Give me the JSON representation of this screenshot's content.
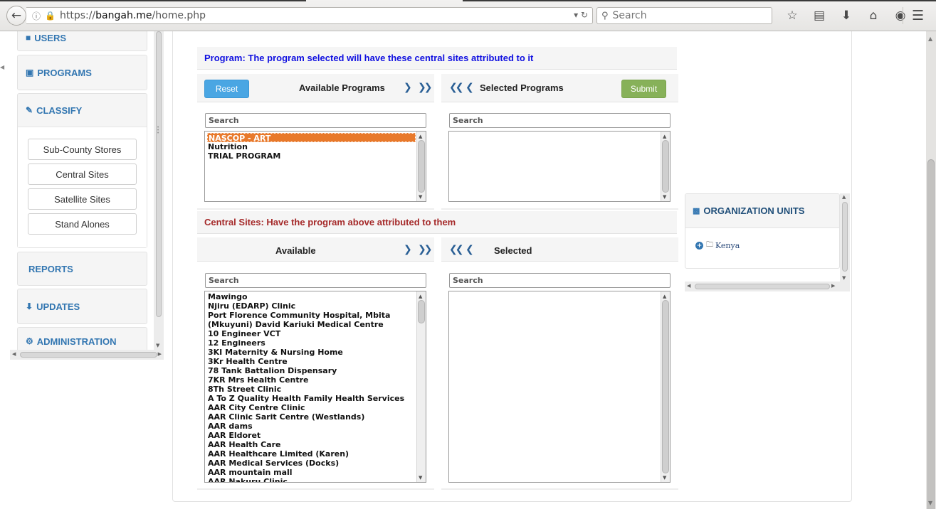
{
  "browser": {
    "url_scheme": "https://",
    "url_domain": "bangah.me",
    "url_path": "/home.php",
    "search_placeholder": "Search"
  },
  "sidebar": {
    "items": [
      {
        "label": "USERS",
        "icon": "users-icon"
      },
      {
        "label": "PROGRAMS",
        "icon": "briefcase-icon"
      },
      {
        "label": "CLASSIFY",
        "icon": "edit-icon"
      },
      {
        "label": "REPORTS"
      },
      {
        "label": "UPDATES",
        "icon": "download-icon"
      },
      {
        "label": "ADMINISTRATION",
        "icon": "cogs-icon"
      }
    ],
    "classify_sub": [
      "Sub-County Stores",
      "Central Sites",
      "Satellite Sites",
      "Stand Alones"
    ]
  },
  "program_section": {
    "title": "Program: The program selected will have these central sites attributed to it",
    "available_title": "Available Programs",
    "selected_title": "Selected Programs",
    "reset_label": "Reset",
    "submit_label": "Submit",
    "search_placeholder": "Search",
    "available_items": [
      "NASCOP - ART",
      "Nutrition",
      "TRIAL PROGRAM"
    ],
    "selected_item_index": 0
  },
  "sites_section": {
    "title": "Central Sites: Have the program above attributed to them",
    "available_title": "Available",
    "selected_title": "Selected",
    "search_placeholder": "Search",
    "available_items": [
      "Mawingo",
      "Njiru (EDARP) Clinic",
      "Port Florence Community Hospital, Mbita",
      "(Mkuyuni) David Kariuki Medical Centre",
      "10 Engineer VCT",
      "12 Engineers",
      "3KI Maternity & Nursing Home",
      "3Kr Health Centre",
      "78 Tank Battalion Dispensary",
      "7KR Mrs Health Centre",
      "8Th Street Clinic",
      "A To Z Quality Health Family Health Services",
      "AAR City Centre Clinic",
      "AAR Clinic Sarit Centre (Westlands)",
      "AAR dams",
      "AAR Eldoret",
      "AAR Health Care",
      "AAR Healthcare Limited (Karen)",
      "AAR Medical Services (Docks)",
      "AAR mountain mall",
      "AAR Nakuru Clinic"
    ]
  },
  "org_units": {
    "title": "ORGANIZATION UNITS",
    "root": "Kenya"
  },
  "colors": {
    "link_blue": "#3276b1",
    "program_title": "#1010e0",
    "sites_title": "#a52a2a",
    "reset_button": "#4aa6e3",
    "submit_button": "#87b159",
    "selected_option": "#e8792b"
  }
}
